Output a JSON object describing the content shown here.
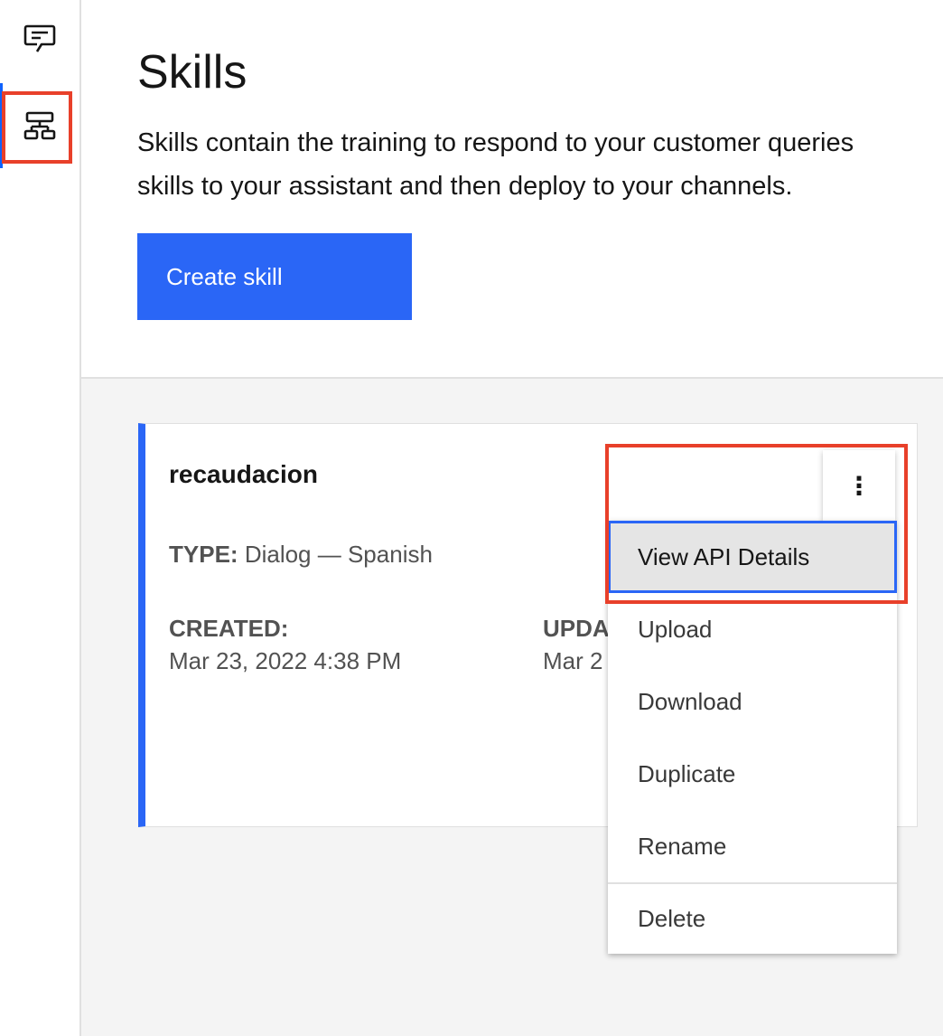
{
  "sidebar": {
    "items": [
      {
        "icon": "chat-icon"
      },
      {
        "icon": "skills-tree-icon",
        "active": true
      }
    ]
  },
  "header": {
    "title": "Skills",
    "description_line1": "Skills contain the training to respond to your customer queries",
    "description_line2": "skills to your assistant and then deploy to your channels.",
    "create_label": "Create skill"
  },
  "card": {
    "title": "recaudacion",
    "type_label": "TYPE:",
    "type_value": "Dialog — Spanish",
    "created_label": "CREATED:",
    "created_value": "Mar 23, 2022 4:38 PM",
    "updated_label": "UPDA",
    "updated_value": "Mar 2"
  },
  "menu": {
    "items": [
      "View API Details",
      "Upload",
      "Download",
      "Duplicate",
      "Rename",
      "Delete"
    ]
  },
  "colors": {
    "accent": "#2a66f6",
    "annotation": "#e8402a"
  }
}
